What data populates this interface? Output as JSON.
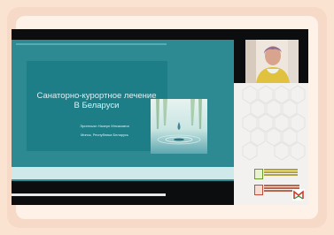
{
  "slide": {
    "title_line1": "Санаторно-курортное лечение",
    "title_line2": "В Беларуси",
    "author": "Эрингсьян Назерн Мнсаковна",
    "city": "Минск, Республика Беларусь"
  },
  "colors": {
    "page_bg": "#fbe3d2",
    "slide_teal": "#2d8a93",
    "panel_teal": "#1e7e88",
    "stage_black": "#0c0d0f"
  },
  "icons": {
    "water_drop_photo": "water-drop-image",
    "presenter_video": "webcam-feed",
    "institution_logo": "logo-emblem",
    "brand_logo": "corner-brand-icon"
  }
}
